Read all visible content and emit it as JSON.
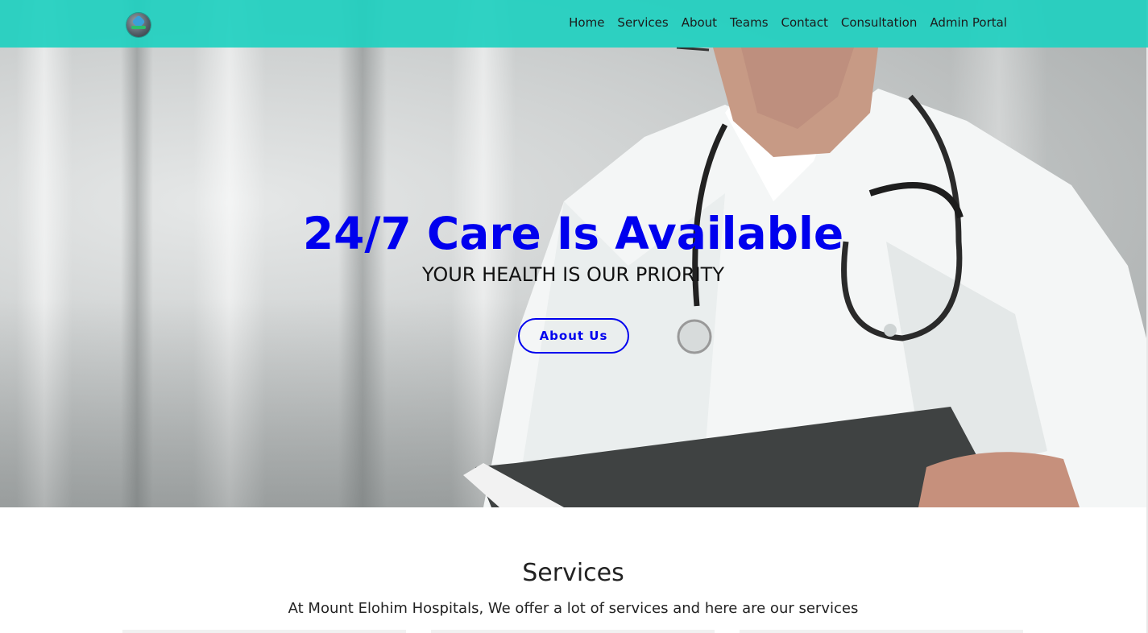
{
  "nav": {
    "items": [
      "Home",
      "Services",
      "About",
      "Teams",
      "Contact",
      "Consultation",
      "Admin Portal"
    ]
  },
  "hero": {
    "title": "24/7 Care Is Available",
    "subtitle": "YOUR HEALTH IS OUR PRIORITY",
    "button_label": "About Us"
  },
  "services": {
    "title": "Services",
    "description": "At Mount Elohim Hospitals, We offer a lot of services and here are our services"
  },
  "colors": {
    "nav_bg": "#20d0c0",
    "accent": "#0000ee"
  }
}
